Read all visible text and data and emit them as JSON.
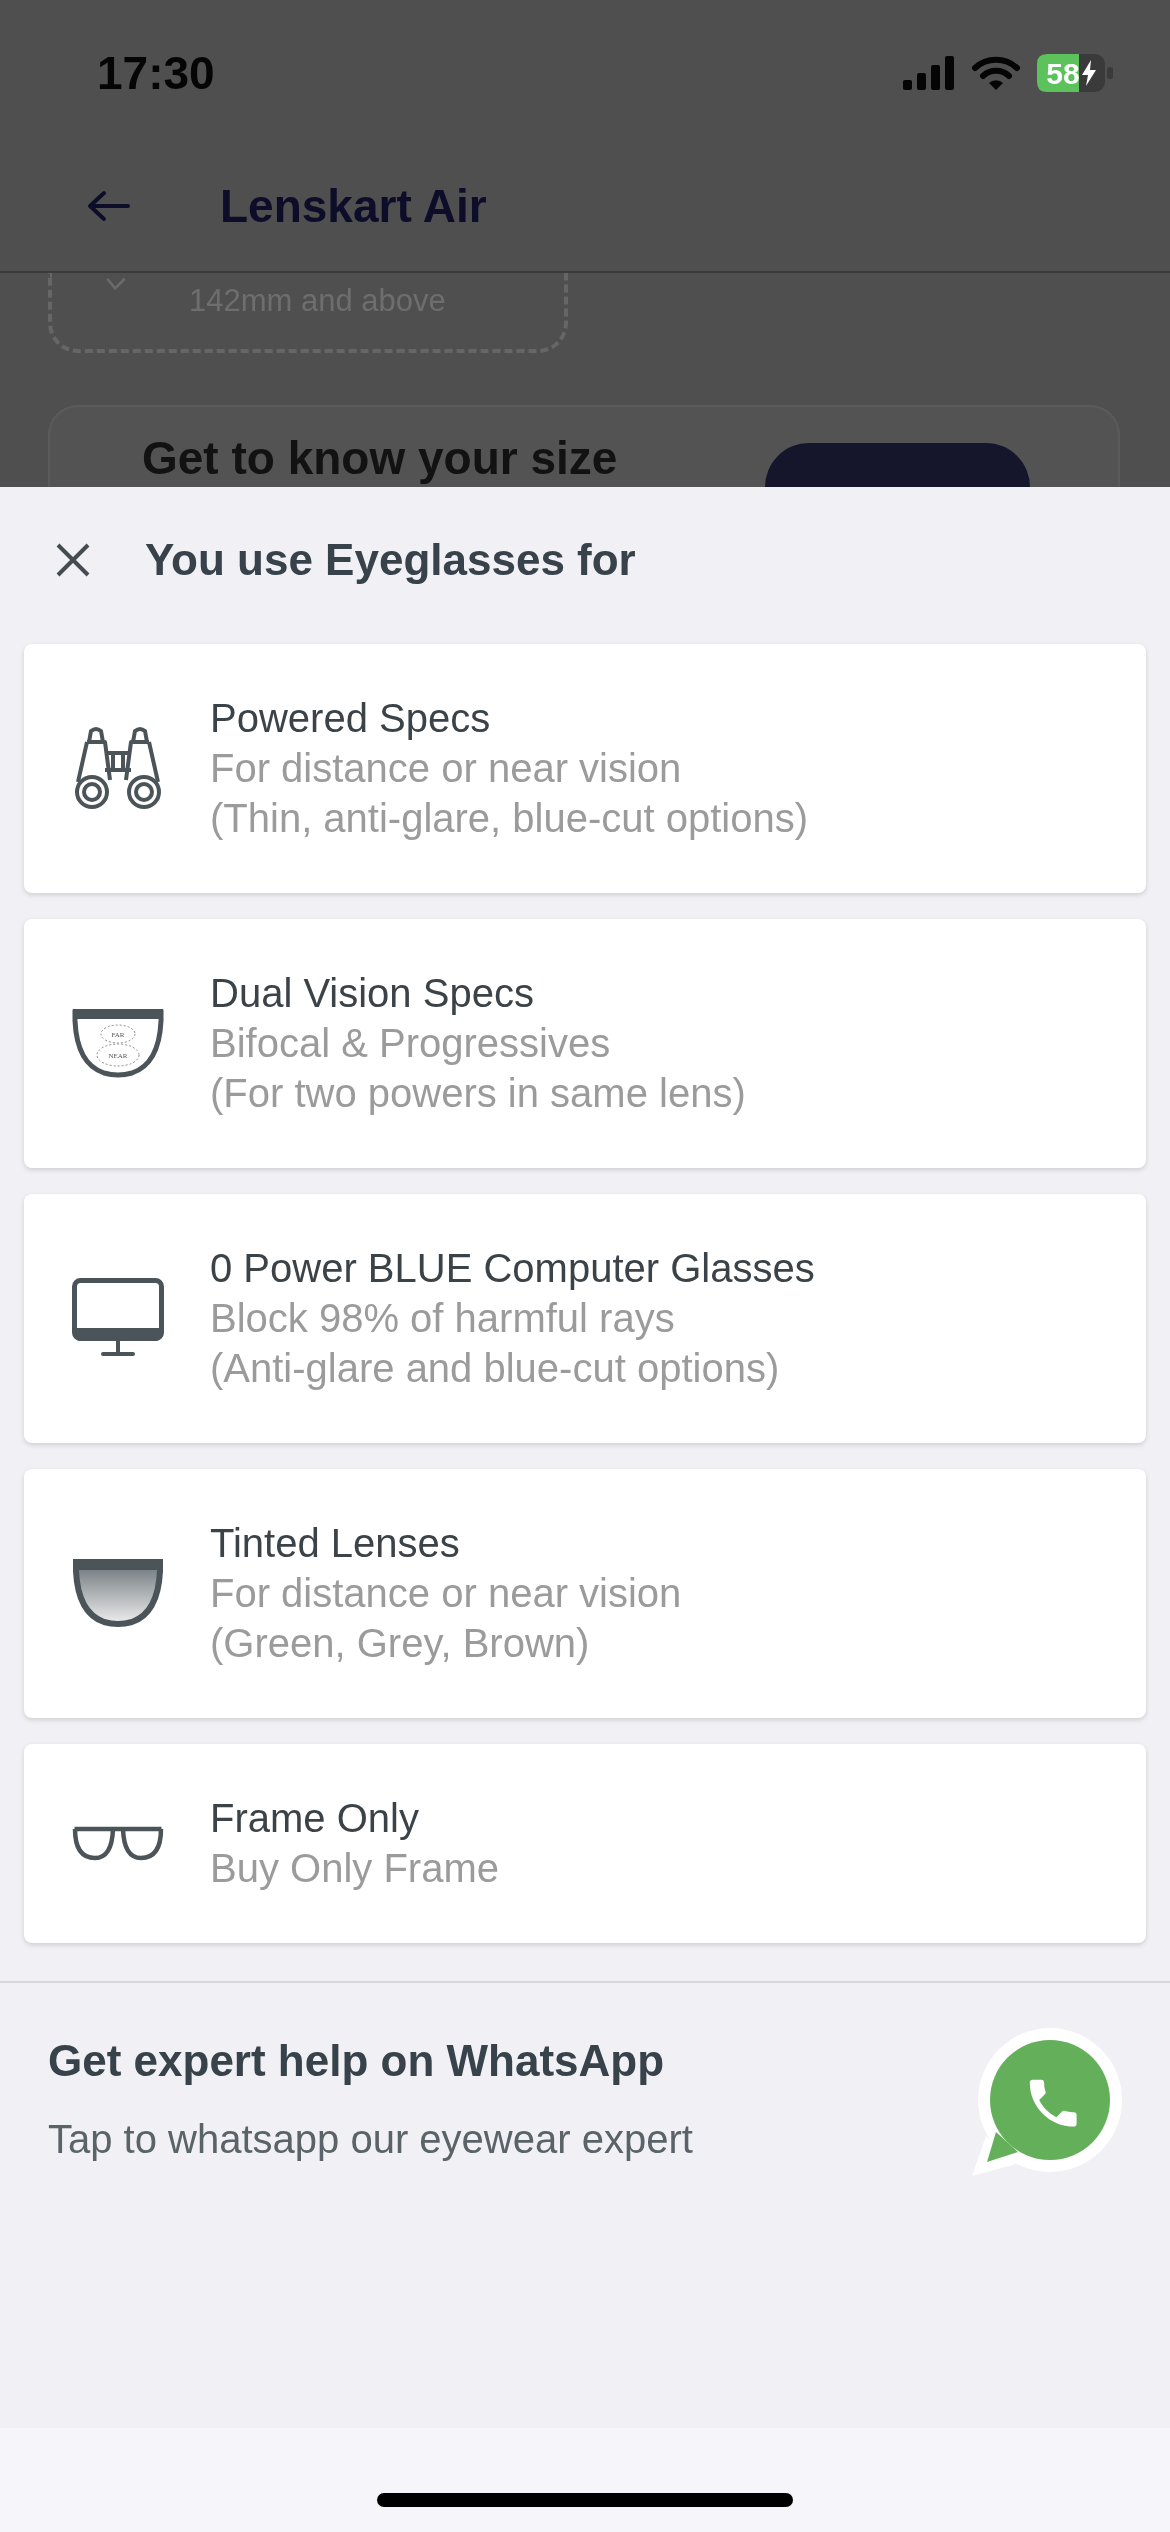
{
  "status_bar": {
    "time": "17:30",
    "battery": "58",
    "charging": true
  },
  "page": {
    "title": "Lenskart Air",
    "size_card": {
      "text": "142mm and above"
    },
    "promo_card": {
      "title": "Get to know your size"
    }
  },
  "sheet": {
    "title": "You use Eyeglasses for",
    "options": [
      {
        "title": "Powered Specs",
        "details": [
          "For distance or near vision",
          "(Thin, anti-glare, blue-cut options)"
        ]
      },
      {
        "title": "Dual Vision Specs",
        "details": [
          "Bifocal & Progressives",
          "(For two powers in same lens)"
        ],
        "icon_labels": [
          "FAR",
          "NEAR"
        ]
      },
      {
        "title": "0 Power BLUE Computer Glasses",
        "details": [
          "Block 98% of harmful rays",
          "(Anti-glare and blue-cut options)"
        ]
      },
      {
        "title": "Tinted Lenses",
        "details": [
          "For distance or near vision",
          "(Green, Grey, Brown)"
        ]
      },
      {
        "title": "Frame Only",
        "details": [
          "Buy Only Frame"
        ]
      }
    ]
  },
  "help": {
    "title": "Get expert help on WhatsApp",
    "subtitle": "Tap to whatsapp our eyewear expert"
  }
}
